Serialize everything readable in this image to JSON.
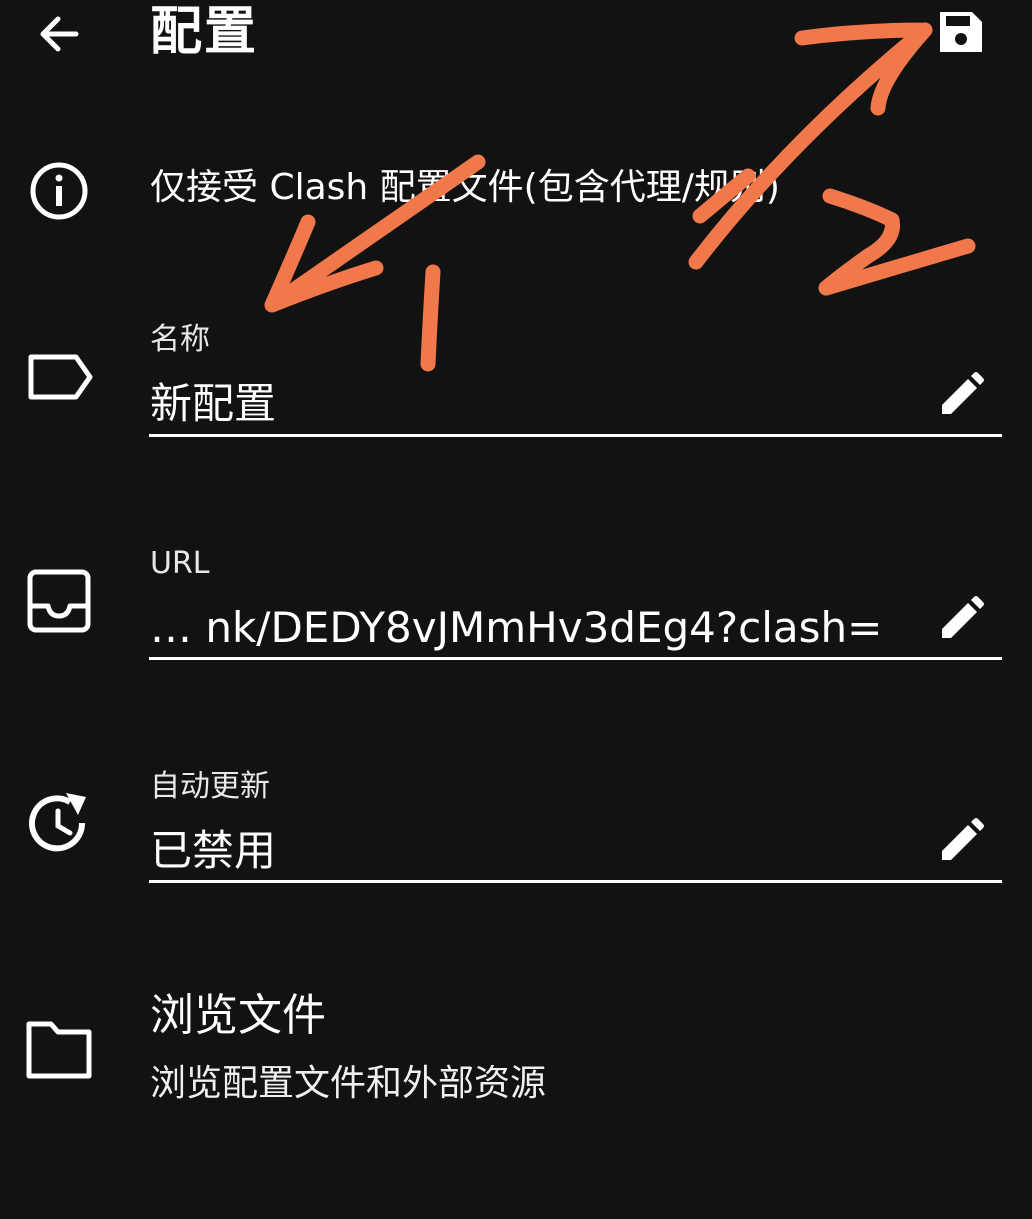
{
  "header": {
    "title": "配置",
    "back_icon": "arrow-back-icon",
    "save_icon": "save-icon"
  },
  "info": {
    "icon": "info-icon",
    "text": "仅接受 Clash 配置文件(包含代理/规则)"
  },
  "fields": {
    "name": {
      "label": "名称",
      "value": "新配置",
      "icon": "label-tag-icon"
    },
    "url": {
      "label": "URL",
      "value": "…   nk/DEDY8vJMmHv3dEg4?clash=",
      "icon": "inbox-icon"
    },
    "auto_update": {
      "label": "自动更新",
      "value": "已禁用",
      "icon": "update-clock-icon"
    }
  },
  "browse": {
    "title": "浏览文件",
    "subtitle": "浏览配置文件和外部资源",
    "icon": "folder-icon"
  },
  "annotations": {
    "marker_1": "1",
    "marker_2": "2",
    "stroke_color": "#f0784a"
  },
  "colors": {
    "background": "#121212",
    "foreground": "#ffffff",
    "annotation": "#f0784a"
  }
}
